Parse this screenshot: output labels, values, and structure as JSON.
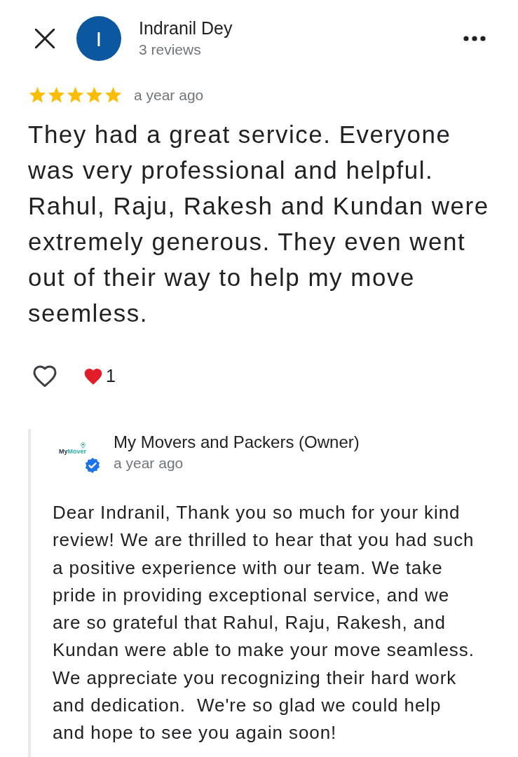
{
  "reviewer": {
    "initial": "I",
    "name": "Indranil Dey",
    "review_count": "3 reviews"
  },
  "review": {
    "stars": 5,
    "time": "a year ago",
    "text": "They had a great service. Everyone was very professional and helpful. Rahul, Raju, Rakesh and Kundan were extremely generous. They even went out of their way to help my move seemless.",
    "liked": false,
    "reaction_count": "1"
  },
  "owner_reply": {
    "logo_text_1": "My",
    "logo_text_2": "Mover",
    "name": "My Movers and Packers (Owner)",
    "time": "a year ago",
    "text": "Dear Indranil, Thank you so much for your kind review! We are thrilled to hear that you had such a positive experience with our team. We take pride in providing exceptional service, and we are so grateful that Rahul, Raju, Rakesh, and Kundan were able to make your move seamless. We appreciate you recognizing their hard work and dedication.  We're so glad we could help and hope to see you again soon!"
  }
}
